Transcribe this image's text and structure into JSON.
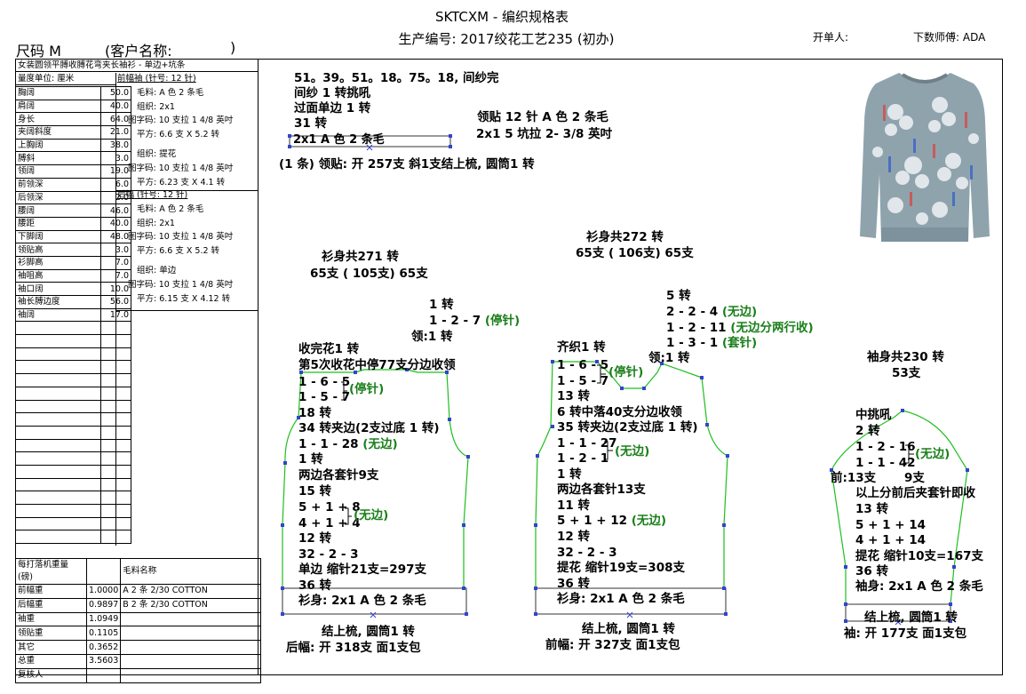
{
  "header": {
    "title": "SKTCXM - 编织规格表",
    "production_no": "生产编号: 2017绞花工艺235 (初办)",
    "issuer": "开单人:",
    "designer": "下数师傅: ADA"
  },
  "size": {
    "label": "尺码  M",
    "customer": "(客户名称:",
    "customer_close": ")"
  },
  "left_panel": {
    "style_desc": "女装圆领平膊收膊花弯夹长袖衫 - 单边+坑条",
    "unit": "量度单位: 厘米",
    "measurements": [
      {
        "name": "胸阔",
        "value": "50.0"
      },
      {
        "name": "肩阔",
        "value": "40.0"
      },
      {
        "name": "身长",
        "value": "64.0"
      },
      {
        "name": "夹阔斜度",
        "value": "21.0"
      },
      {
        "name": "上胸阔",
        "value": "38.0"
      },
      {
        "name": "膊斜",
        "value": "3.0"
      },
      {
        "name": "领阔",
        "value": "19.0"
      },
      {
        "name": "前领深",
        "value": "6.0"
      },
      {
        "name": "后领深",
        "value": "2.0"
      },
      {
        "name": "腰阔",
        "value": "46.0"
      },
      {
        "name": "腰距",
        "value": "40.0"
      },
      {
        "name": "下脚阔",
        "value": "48.0"
      },
      {
        "name": "领贴高",
        "value": "3.0"
      },
      {
        "name": "衫脚高",
        "value": "7.0"
      },
      {
        "name": "袖咀高",
        "value": "7.0"
      },
      {
        "name": "袖口阔",
        "value": "10.0"
      },
      {
        "name": "袖长膊边度",
        "value": "56.0"
      },
      {
        "name": "袖阔",
        "value": "17.0"
      }
    ],
    "rib_front": {
      "heading": "前幅袖 (针号: 12 针)",
      "yarn": "毛料: A 色 2 条毛",
      "rib": "组织: 2x1",
      "gauge": "图字码: 10 支拉 1 4/8 英吋",
      "square": "平方: 6.6 支 X  5.2 转",
      "org2": "组织: 提花",
      "gauge2": "图字码: 10 支拉 1 4/8 英吋",
      "square2": "平方: 6.23 支 X  4.1 转"
    },
    "rib_back": {
      "heading": "后幅 (针号: 12 针)",
      "yarn": "毛料: A 色 2 条毛",
      "rib": "组织: 2x1",
      "gauge": "图字码: 10 支拉 1 4/8 英吋",
      "square": "平方: 6.6 支 X  5.2 转",
      "org2": "组织: 单边",
      "gauge2": "图字码: 10 支拉 1 4/8 英吋",
      "square2": "平方: 6.15 支 X  4.12 转"
    },
    "weights_header": [
      "每打落机重量 (磅)",
      "",
      "毛料名称"
    ],
    "weights": [
      {
        "name": "前幅重",
        "value": "1.0000",
        "yarn": "A  2 条 2/30 COTTON"
      },
      {
        "name": "后幅重",
        "value": "0.9897",
        "yarn": "B  2 条 2/30 COTTON"
      },
      {
        "name": "袖重",
        "value": "1.0949",
        "yarn": ""
      },
      {
        "name": "领贴重",
        "value": "0.1105",
        "yarn": ""
      },
      {
        "name": "其它",
        "value": "0.3652",
        "yarn": ""
      },
      {
        "name": "总重",
        "value": "3.5603",
        "yarn": ""
      },
      {
        "name": "复核人",
        "value": "",
        "yarn": ""
      }
    ]
  },
  "collar": {
    "line1": "51。39。51。18。75。18, 间纱完",
    "line2": "间纱 1 转挑吼",
    "line3": "过面单边 1 转",
    "line4": "31 转",
    "box": "2x1  A 色 2 条毛",
    "open": "(1 条) 领贴: 开 257支 斜1支结上梳, 圆筒1 转",
    "trim1": "领贴  12 针 A 色 2 条毛",
    "trim2": "2x1   5 坑拉 2- 3/8 英吋"
  },
  "back": {
    "total": "衫身共271 转",
    "total2": "65支 ( 105支) 65支",
    "top1": "1 转",
    "top2": "1 - 2 - 7",
    "top2_g": "(停针)",
    "top3": "领:1 转",
    "l1": "收完花1 转",
    "l2": "第5次收花中停77支分边收领",
    "l3": "1 - 6 - 5",
    "l4": "1 - 5 - 7",
    "l34_g": "(停针)",
    "l5": "18 转",
    "l6": "34 转夹边(2支过底 1 转)",
    "l7": "1 - 1 - 28",
    "l7_g": "(无边)",
    "l8": "1 转",
    "l9": "两边各套针9支",
    "l10": "15 转",
    "l11": "5 + 1 + 8",
    "l12": "4 + 1 + 4",
    "l1112_g": "(无边)",
    "l13": "12 转",
    "l14": "32 - 2 - 3",
    "l15": "单边 缩针21支=297支",
    "l16": "36 转",
    "l17": "衫身: 2x1   A 色 2 条毛",
    "b1": "结上梳, 圆筒1 转",
    "b2": "后幅: 开 318支 面1支包"
  },
  "front": {
    "total": "衫身共272 转",
    "total2": "65支 ( 106支) 65支",
    "top1": "5 转",
    "top2": "2 - 2 - 4",
    "top2_g": "(无边)",
    "top3": "1 - 2 - 11",
    "top3_g": "(无边分两行收)",
    "top4": "1 - 3 - 1",
    "top4_g": "(套针)",
    "top5": "领:1 转",
    "l1": "齐织1 转",
    "l2": "1 - 6 - 5",
    "l3": "1 - 5 - 7",
    "l23_g": "(停针)",
    "l4": "13 转",
    "l5": "6 转中落40支分边收领",
    "l6": "35 转夹边(2支过底 1 转)",
    "l7": "1 - 1 - 27",
    "l8": "1 - 2 - 1",
    "l78_g": "(无边)",
    "l9": "1 转",
    "l10": "两边各套针13支",
    "l11": "11 转",
    "l12": "5 + 1 + 12",
    "l12_g": "(无边)",
    "l13": "12 转",
    "l14": "32 - 2 - 3",
    "l15": "提花 缩针19支=308支",
    "l16": "36 转",
    "l17": "衫身: 2x1   A 色 2 条毛",
    "b1": "结上梳, 圆筒1 转",
    "b2": "前幅: 开 327支 面1支包"
  },
  "sleeve": {
    "total": "袖身共230 转",
    "total2": "53支",
    "l1": "中挑吼",
    "l2": "2 转",
    "l3": "1 - 2 - 16",
    "l4": "1 - 1 - 42",
    "l34_g": "(无边)",
    "l5a": "前:13支",
    "l5b": "9支",
    "l6": "以上分前后夹套针即收",
    "l7": "13 转",
    "l8": "5 + 1 + 14",
    "l9": "4 + 1 + 14",
    "l10": "提花 缩针10支=167支",
    "l11": "36 转",
    "l12": "袖身: 2x1   A 色 2 条毛",
    "b1": "结上梳, 圆筒1 转",
    "b2": "袖: 开 177支 面1支包"
  },
  "colors": {
    "outline": "#1fbf1f",
    "note_green": "#1a7f1a",
    "node": "#2233cc",
    "sweater": "#8fa3ad"
  }
}
